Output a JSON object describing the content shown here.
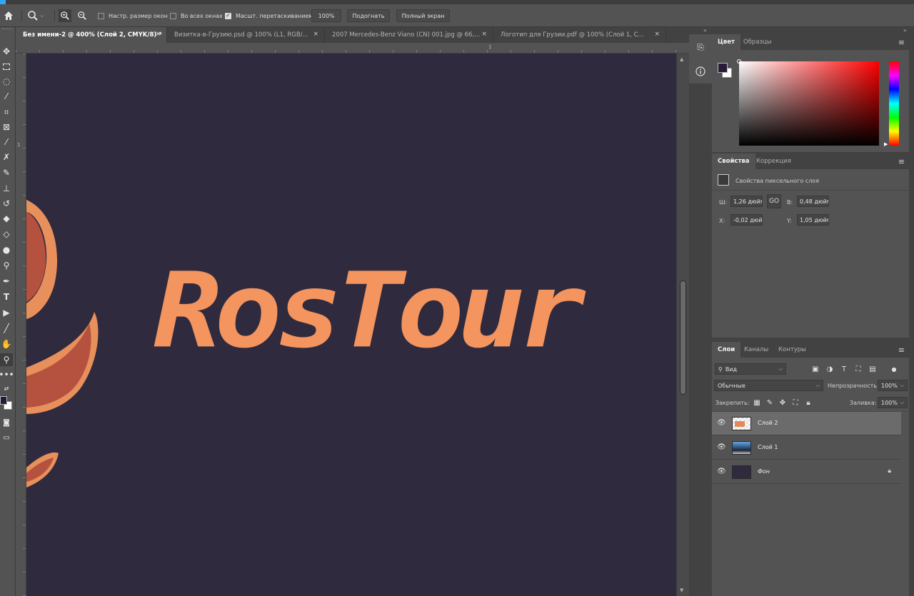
{
  "app": {
    "accent": "#31a8ff",
    "canvas_bg": "#2f2a3e",
    "logo_color": "#f4945e"
  },
  "options_bar": {
    "home_icon": "home-icon",
    "zoom_tool_icon": "zoom-icon",
    "resize_windows_label": "Настр. размер окон",
    "all_windows_label": "Во всех окнах",
    "scrubby_zoom_label": "Масшт. перетаскиванием",
    "zoom_value": "100%",
    "fit_label": "Подогнать",
    "fullscreen_label": "Полный экран"
  },
  "tabs": [
    {
      "label": "Без имени-2 @ 400% (Слой 2, CMYK/8) *"
    },
    {
      "label": "Визитка-в-Грузию.psd @ 100% (L1, RGB/..."
    },
    {
      "label": "2007 Mercedes-Benz Viano (CN) 001.jpg @ 66,..."
    },
    {
      "label": "Логотип для Грузии.pdf @ 100% (Слой 1, С..."
    }
  ],
  "tab_close": "×",
  "rulers": {
    "top_mark": "1",
    "left_mark": "1"
  },
  "canvas": {
    "logo_text": "RosTour"
  },
  "color_panel": {
    "tabs": [
      "Цвет",
      "Образцы"
    ],
    "foreground": "#2a1a3a",
    "background": "#ffffff"
  },
  "properties_panel": {
    "tabs": [
      "Свойства",
      "Коррекция"
    ],
    "section_title": "Свойства пиксельного слоя",
    "w_label": "Ш:",
    "w_value": "1,26 дюйм",
    "h_label": "В:",
    "h_value": "0,48 дюйм",
    "x_label": "X:",
    "x_value": "-0,02 дюй",
    "y_label": "Y:",
    "y_value": "1,05 дюйм",
    "link_label": "GO"
  },
  "layers_panel": {
    "tabs": [
      "Слои",
      "Каналы",
      "Контуры"
    ],
    "filter_label": "Вид",
    "blend_mode": "Обычные",
    "opacity_label": "Непрозрачность:",
    "opacity_value": "100%",
    "lock_label": "Закрепить:",
    "fill_label": "Заливка:",
    "fill_value": "100%",
    "layers": [
      {
        "name": "Слой 2"
      },
      {
        "name": "Слой 1"
      },
      {
        "name": "Фон"
      }
    ]
  }
}
